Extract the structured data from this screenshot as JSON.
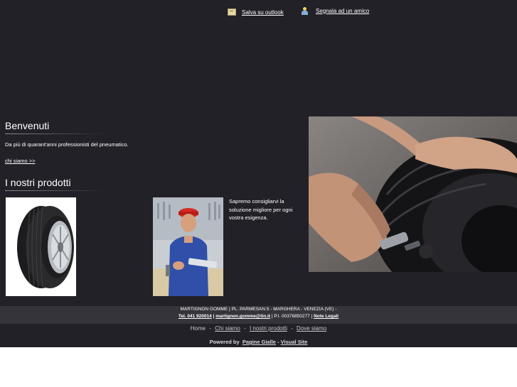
{
  "header": {
    "save_outlook": {
      "label": "Salva su outlook",
      "icon": "outlook-card-icon"
    },
    "tell_friend": {
      "label": "Segnala ad un amico",
      "icon": "person-icon"
    }
  },
  "welcome": {
    "title": "Benvenuti",
    "intro": "Da più di quarant'anni professionisti del pneumatico.",
    "link": "chi siamo >>"
  },
  "products": {
    "title": "I nostri prodotti",
    "tire_image": "tire-image",
    "mechanic_image": "mechanic-image",
    "advice": "Sapremo consigliarvi la soluzione migliore per ogni vostra esigenza."
  },
  "hero": {
    "image": "tire-pressure-gauge-photo"
  },
  "footer": {
    "address": "MARTIGNON GOMME | PL. PARMESAN 5 - MARGHERA - VENEZIA (VE) -",
    "phone": "Tel. 041 920014",
    "sep1": "|",
    "email": "martignon.gomme@tin.it",
    "vat": "| P.I. 00376850277 |",
    "legal": "Note Legali"
  },
  "nav": {
    "items": [
      "Home",
      "Chi siamo",
      "I nostri prodotti",
      "Dove siamo"
    ],
    "separator": "-"
  },
  "powered": {
    "prefix": "Powered by",
    "brand1": "Pagine Gialle",
    "dash": "-",
    "brand2": "Visual Site"
  },
  "colors": {
    "page_background": "#222128",
    "footer_band": "#35343a",
    "text": "#ffffff"
  }
}
